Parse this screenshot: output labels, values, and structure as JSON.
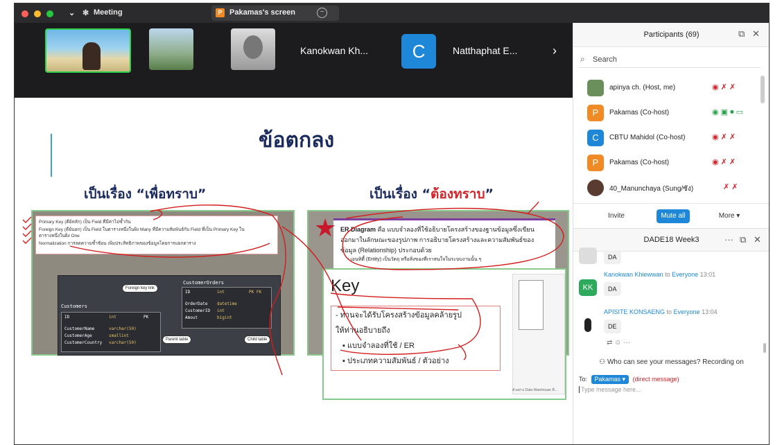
{
  "window": {
    "app_title": "Meeting",
    "screen_tab_label": "Pakamas's screen",
    "screen_tab_initial": "P",
    "min_glyph": "−"
  },
  "video_strip": {
    "names": [
      "Kanokwan Kh...",
      "Natthaphat E..."
    ],
    "c_initial": "C",
    "next_arrow": "›"
  },
  "slide": {
    "title": "ข้อตกลง",
    "left_heading": "เป็นเรื่อง “เพื่อทราบ”",
    "right_heading_prefix": "เป็นเรื่อง “",
    "right_heading_red": "ต้องทราบ",
    "right_heading_suffix": "”",
    "left_lines": [
      "Primary Key (คีย์หลัก) เป็น Field ที่มีค่าไม่ซ้ำกัน",
      "Foreign Key (คีย์นอก) เป็น Field ในตารางหนึ่งในฝั่ง Many ที่มีความสัมพันธ์กับ Field ที่เป็น Primary Key ใน",
      "ตารางหนึ่งในฝั่ง One",
      "Normalization การลดความซ้ำซ้อน เพิ่มประสิทธิภาพของข้อมูลโดยการแยกตาราง"
    ],
    "diagram": {
      "orders_title": "CustomerOrders",
      "customers_title": "Customers",
      "fk_label": "Foreign key link",
      "parent_label": "Parent table",
      "child_label": "Child table",
      "orders_rows": [
        {
          "k": "ID",
          "t": "int",
          "f": "PK FK"
        },
        {
          "k": "OrderDate",
          "t": "datetime",
          "f": ""
        },
        {
          "k": "CustomerID",
          "t": "int",
          "f": ""
        },
        {
          "k": "Amout",
          "t": "bigint",
          "f": ""
        }
      ],
      "customer_rows": [
        {
          "k": "ID",
          "t": "int",
          "f": "PK"
        },
        {
          "k": "CustomerName",
          "t": "varchar(50)",
          "f": ""
        },
        {
          "k": "CustomerAge",
          "t": "smallint",
          "f": ""
        },
        {
          "k": "CustomerCountry",
          "t": "varchar(50)",
          "f": ""
        }
      ]
    },
    "er_lead": "ER Diagram",
    "er_text_1": " คือ แบบจำลองที่ใช้อธิบายโครงสร้างของฐานข้อมูลซึ่งเขียน",
    "er_text_2": "ออกมาในลักษณะของรูปภาพ การอธิบายโครงสร้างและความสัมพันธ์ของ",
    "er_text_3": "ข้อมูล (Relationship) ประกอบด้วย",
    "er_bullet": "• เอนทิตี้ (Entity) เป็นวัตถุ หรือสิ่งของที่เราสนใจในระบบงานนั้น ๆ",
    "key_title": "Key",
    "key_lines": [
      "- ท่านจะได้รับโครงสร้างข้อมูลคล้ายรูป",
      "ให้ท่านอธิบายถึง",
      "▪  แบบจำลองที่ใช้ / ER",
      "▪  ประเภทความสัมพันธ์ / ตัวอย่าง"
    ],
    "thumb_caption": "ตัวอย่าง Data Warehouse ที่..."
  },
  "participants": {
    "title": "Participants (69)",
    "popout_glyph": "⧉",
    "close_glyph": "✕",
    "search_placeholder": "Search",
    "search_glyph": "⌕",
    "rows": [
      {
        "name": "apinya ch. (Host, me)",
        "initial": "",
        "color": "#6b8f5a",
        "icons": "◉  ✗  ✗"
      },
      {
        "name": "Pakamas (Co-host)",
        "initial": "P",
        "color": "#f08a24",
        "icons": "◉ ▣  ⏺  ▭"
      },
      {
        "name": "CBTU Mahidol (Co-host)",
        "initial": "C",
        "color": "#1e87d8",
        "icons": "◉  ✗  ✗"
      },
      {
        "name": "Pakamas (Co-host)",
        "initial": "P",
        "color": "#f08a24",
        "icons": "◉  ✗  ✗"
      },
      {
        "name": "40_Manunchaya (Sung/ซัง)",
        "initial": "",
        "color": "#5a3b30",
        "icons": "✗  ✗"
      }
    ],
    "invite_label": "Invite",
    "mute_all_label": "Mute all",
    "more_label": "More ▾"
  },
  "chat": {
    "title": "DADE18 Week3",
    "more_glyph": "···",
    "popout_glyph": "⧉",
    "close_glyph": "✕",
    "messages": [
      {
        "sender": "",
        "to": "",
        "time": "",
        "text": "DA",
        "initial": "",
        "color": "#ccc"
      },
      {
        "sender": "Kanokwan Khiewwan",
        "to": " to ",
        "target": "Everyone",
        "time": "  13:01",
        "text": "DA",
        "initial": "KK",
        "color": "#2eaa5c"
      },
      {
        "sender": "APISITE KONSAENG",
        "to": " to ",
        "target": "Everyone",
        "time": "  13:04",
        "text": "DE",
        "initial": "",
        "color": "#333"
      }
    ],
    "reactions": "⇄  ☺  ···",
    "who_can_see": "Who can see your messages? Recording on",
    "to_label": "To:",
    "to_chip": "Pakamas ▾",
    "to_dm": "(direct message)",
    "input_placeholder": "Type message here..."
  }
}
